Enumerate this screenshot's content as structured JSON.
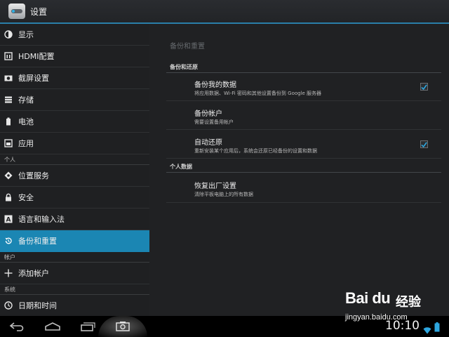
{
  "app": {
    "title": "设置"
  },
  "sidebar": {
    "items": [
      {
        "label": "显示",
        "icon": "display-icon"
      },
      {
        "label": "HDMI配置",
        "icon": "hdmi-icon"
      },
      {
        "label": "截屏设置",
        "icon": "camera-icon"
      },
      {
        "label": "存储",
        "icon": "storage-icon"
      },
      {
        "label": "电池",
        "icon": "battery-icon"
      },
      {
        "label": "应用",
        "icon": "apps-icon"
      }
    ],
    "category_personal": "个人",
    "personal_items": [
      {
        "label": "位置服务",
        "icon": "location-icon"
      },
      {
        "label": "安全",
        "icon": "lock-icon"
      },
      {
        "label": "语言和输入法",
        "icon": "language-icon"
      },
      {
        "label": "备份和重置",
        "icon": "backup-icon",
        "selected": true
      }
    ],
    "category_accounts": "帐户",
    "accounts_items": [
      {
        "label": "添加帐户",
        "icon": "add-icon"
      }
    ],
    "category_system": "系统",
    "system_items": [
      {
        "label": "日期和时间",
        "icon": "clock-icon"
      }
    ]
  },
  "main": {
    "title": "备份和重置",
    "section_backup": "备份和还原",
    "prefs": [
      {
        "title": "备份我的数据",
        "summary": "将应用数据、Wi-Fi 密码和其他设置备份到 Google 服务器",
        "checked": true
      },
      {
        "title": "备份帐户",
        "summary": "需要设置备用帐户",
        "checked": false
      },
      {
        "title": "自动还原",
        "summary": "重新安装某个应用后，系统会还原已经备份的设置和数据",
        "checked": true
      }
    ],
    "section_personal": "个人数据",
    "factory_reset": {
      "title": "恢复出厂设置",
      "summary": "清除平板电脑上的所有数据"
    }
  },
  "navbar": {
    "buttons": [
      "back-icon",
      "home-icon",
      "recent-apps-icon",
      "screenshot-icon"
    ],
    "time": "10:10"
  },
  "watermark": {
    "logo": "Bai du",
    "brand": "经验",
    "url": "jingyan.baidu.com"
  },
  "colors": {
    "accent": "#1b86b3",
    "actionbar_line": "#2a7fa9",
    "checkmark": "#2ea7e0"
  }
}
